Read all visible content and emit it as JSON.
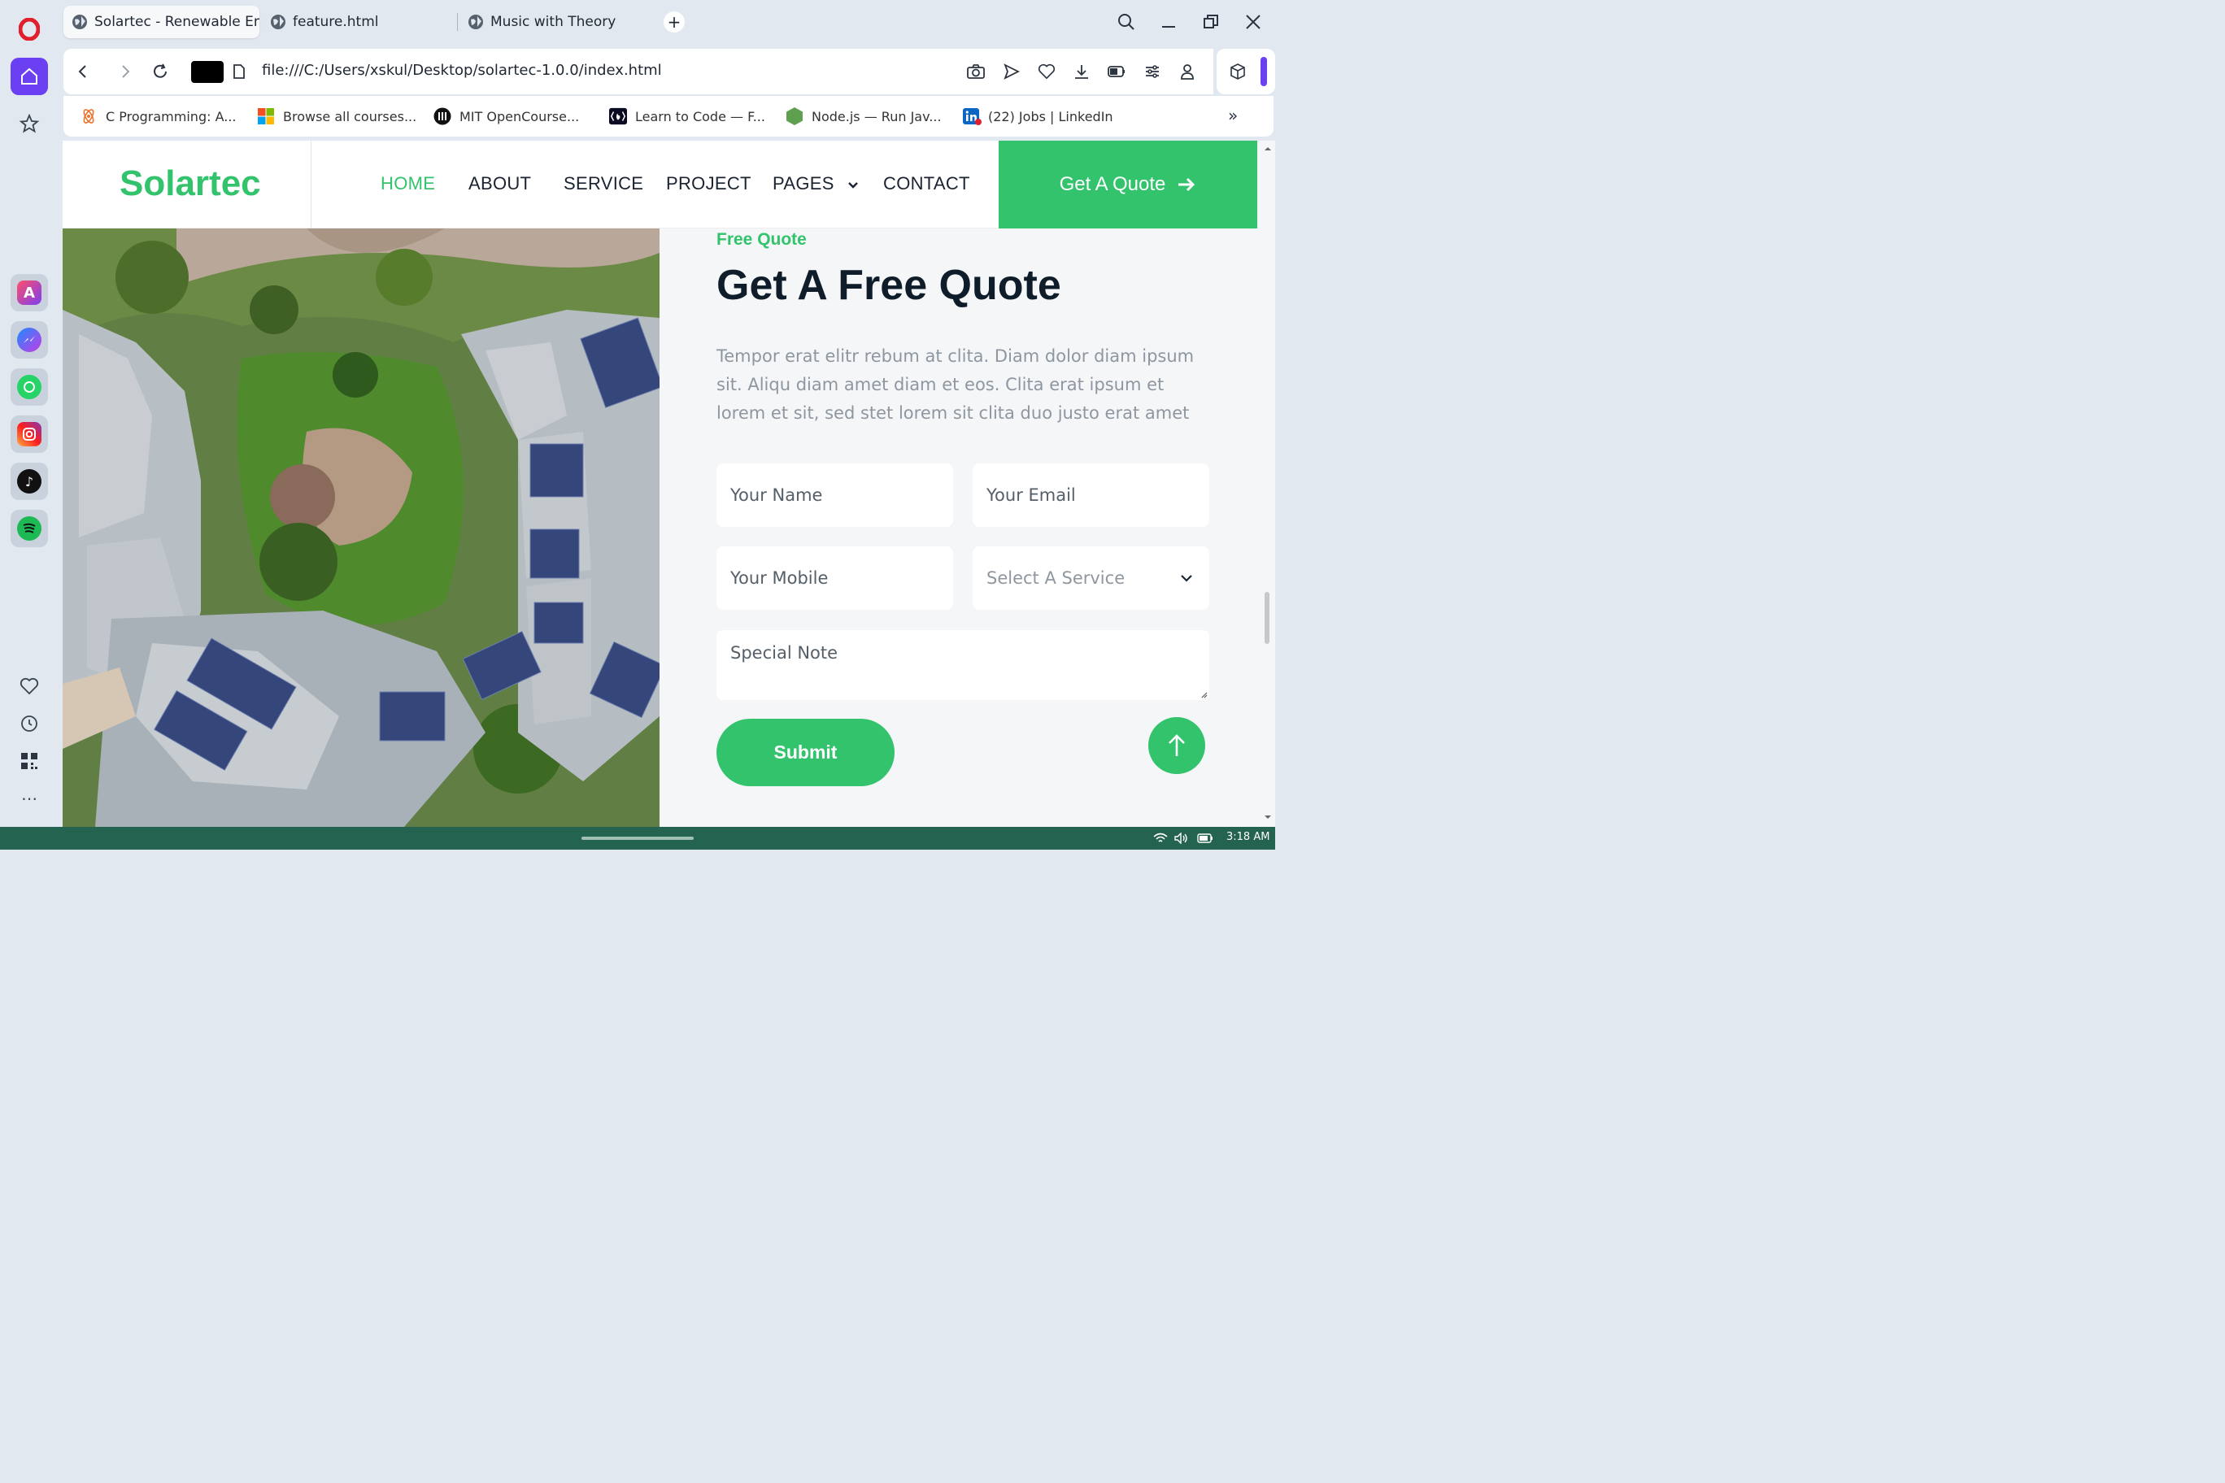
{
  "browser": {
    "tabs": [
      {
        "title": "Solartec - Renewable Energy",
        "active": true
      },
      {
        "title": "feature.html",
        "active": false
      },
      {
        "title": "Music with Theory",
        "active": false
      }
    ],
    "new_tab": "+",
    "url": "file:///C:/Users/xskul/Desktop/solartec-1.0.0/index.html",
    "bookmarks": [
      {
        "label": "C Programming: A...",
        "icon": "atom-icon"
      },
      {
        "label": "Browse all courses...",
        "icon": "microsoft-icon"
      },
      {
        "label": "MIT OpenCourse...",
        "icon": "mit-icon"
      },
      {
        "label": "Learn to Code — F...",
        "icon": "freecodecamp-icon"
      },
      {
        "label": "Node.js — Run Jav...",
        "icon": "nodejs-icon"
      },
      {
        "label": "(22) Jobs | LinkedIn",
        "icon": "linkedin-icon"
      }
    ],
    "more_bookmarks": "»",
    "colors": {
      "opera_red": "#e0202e",
      "active_workspace": "#6b3ff2"
    }
  },
  "site": {
    "brand": "Solartec",
    "menu": [
      "HOME",
      "ABOUT",
      "SERVICE",
      "PROJECT",
      "PAGES",
      "CONTACT"
    ],
    "cta": "Get A Quote",
    "accent": "#32c36c",
    "quote": {
      "eyebrow": "Free Quote",
      "title": "Get A Free Quote",
      "text": "Tempor erat elitr rebum at clita. Diam dolor diam ipsum sit. Aliqu diam amet diam et eos. Clita erat ipsum et lorem et sit, sed stet lorem sit clita duo justo erat amet",
      "name_placeholder": "Your Name",
      "email_placeholder": "Your Email",
      "mobile_placeholder": "Your Mobile",
      "service_placeholder": "Select A Service",
      "note_placeholder": "Special Note",
      "submit": "Submit"
    }
  },
  "taskbar": {
    "time": "3:18 AM"
  }
}
